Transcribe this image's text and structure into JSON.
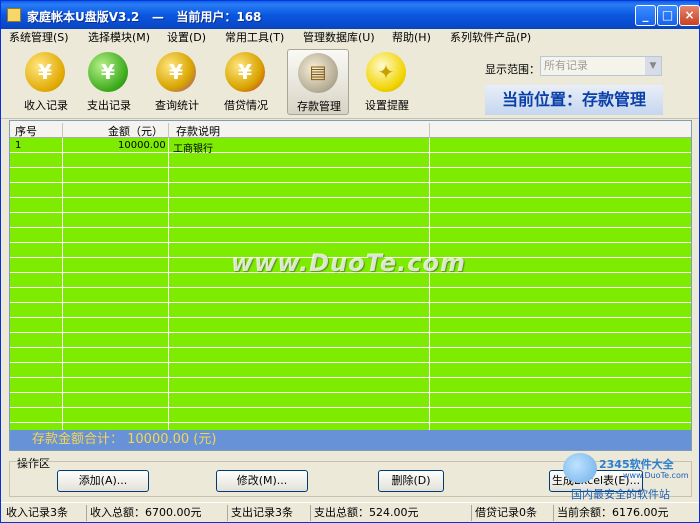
{
  "window": {
    "title": "家庭帐本U盘版V3.2   —   当前用户：168",
    "min_label": "_",
    "max_label": "□",
    "close_label": "×"
  },
  "menu": [
    "系统管理(S)",
    "选择模块(M)",
    "设置(D)",
    "常用工具(T)",
    "管理数据库(U)",
    "帮助(H)",
    "系列软件产品(P)"
  ],
  "toolbar": {
    "items": [
      {
        "label": "收入记录",
        "icon": "yen-income-icon",
        "color": "#e0a800"
      },
      {
        "label": "支出记录",
        "icon": "yen-expense-icon",
        "color": "#38a818"
      },
      {
        "label": "查询统计",
        "icon": "yen-query-icon",
        "color": "#9a50c0"
      },
      {
        "label": "借贷情况",
        "icon": "yen-loan-icon",
        "color": "#c82828"
      },
      {
        "label": "存款管理",
        "icon": "deposit-books-icon",
        "color": "#8a8a8a"
      },
      {
        "label": "设置提醒",
        "icon": "lightbulb-icon",
        "color": "#f2d400"
      }
    ],
    "display_range_label": "显示范围：",
    "display_range_value": "所有记录",
    "location": "当前位置：存款管理"
  },
  "grid": {
    "columns": [
      "序号",
      "金额（元）",
      "存款说明"
    ],
    "rows": [
      {
        "no": "1",
        "amount": "10000.00",
        "desc": "工商银行"
      }
    ],
    "total": "存款金额合计： 10000.00 (元)"
  },
  "watermark": "www.DuoTe.com",
  "operations": {
    "label": "操作区",
    "add": "添加(A)...",
    "edit": "修改(M)...",
    "delete": "删除(D)",
    "excel": "生成Excel表(E)..."
  },
  "logo": {
    "brand": "2345软件大全",
    "url": "www.DuoTe.com",
    "slogan": "国内最安全的软件站"
  },
  "status": [
    "收入记录3条",
    "收入总额：6700.00元",
    "支出记录3条",
    "支出总额：524.00元",
    "借贷记录0条",
    "当前余额：6176.00元"
  ],
  "colors": {
    "grid_bg": "#7eec00",
    "total_bar": "#6792d8",
    "total_text": "#f6d64e",
    "title_bar": "#0a5fe8"
  }
}
